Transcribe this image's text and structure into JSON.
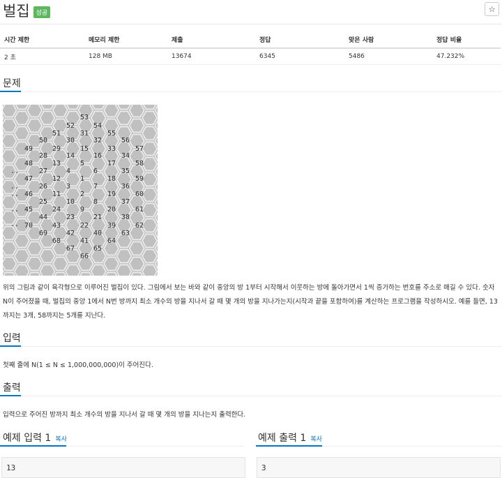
{
  "header": {
    "title": "벌집",
    "badge": "성공",
    "star_icon": "star-icon"
  },
  "info_table": {
    "headers": [
      "시간 제한",
      "메모리 제한",
      "제출",
      "정답",
      "맞은 사람",
      "정답 비율"
    ],
    "values": [
      "2 초",
      "128 MB",
      "13674",
      "6345",
      "5486",
      "47.232%"
    ]
  },
  "problem": {
    "heading": "문제",
    "numbers": [
      "53",
      "52",
      "54",
      "51",
      "31",
      "55",
      "50",
      "30",
      "32",
      "56",
      "49",
      "29",
      "15",
      "33",
      "57",
      "28",
      "14",
      "16",
      "34",
      "48",
      "13",
      "5",
      "17",
      "58",
      "..",
      "27",
      "4",
      "6",
      "35",
      "47",
      "12",
      "1",
      "18",
      "59",
      "..",
      "26",
      "3",
      "7",
      "36",
      "..",
      "46",
      "11",
      "2",
      "19",
      "60",
      "25",
      "10",
      "8",
      "37",
      "..",
      "45",
      "24",
      "9",
      "20",
      "61",
      "44",
      "23",
      "21",
      "38",
      "..",
      "70",
      "43",
      "22",
      "39",
      "62",
      "69",
      "42",
      "40",
      "63",
      "68",
      "41",
      "64",
      "67",
      "65",
      "66"
    ],
    "description": "위의 그림과 같이 육각형으로 이루어진 벌집이 있다. 그림에서 보는 바와 같이 중앙의 방 1부터 시작해서 이웃하는 방에 돌아가면서 1씩 증가하는 번호를 주소로 매길 수 있다. 숫자 N이 주어졌을 때, 벌집의 중앙 1에서 N번 방까지 최소 개수의 방을 지나서 갈 때 몇 개의 방을 지나가는지(시작과 끝을 포함하여)를 계산하는 프로그램을 작성하시오. 예를 들면, 13까지는 3개, 58까지는 5개를 지난다."
  },
  "input": {
    "heading": "입력",
    "text": "첫째 줄에 N(1 ≤ N ≤ 1,000,000,000)이 주어진다."
  },
  "output": {
    "heading": "출력",
    "text": "입력으로 주어진 방까지 최소 개수의 방을 지나서 갈 때 몇 개의 방을 지나는지 출력한다."
  },
  "samples": {
    "input_heading": "예제 입력 1",
    "output_heading": "예제 출력 1",
    "copy_label": "복사",
    "input_value": "13",
    "output_value": "3"
  }
}
